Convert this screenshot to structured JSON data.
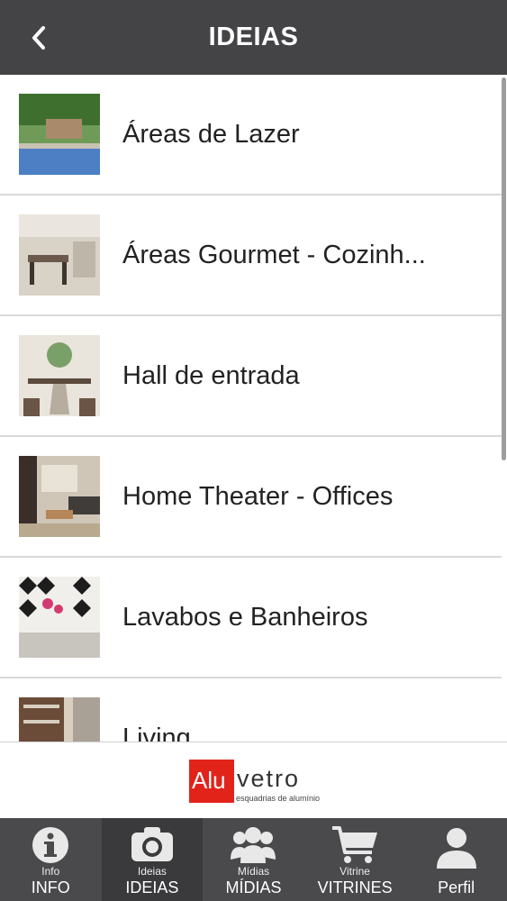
{
  "header": {
    "title": "IDEIAS"
  },
  "items": [
    {
      "label": "Áreas de Lazer"
    },
    {
      "label": "Áreas Gourmet - Cozinh..."
    },
    {
      "label": "Hall de entrada"
    },
    {
      "label": "Home Theater - Offices"
    },
    {
      "label": "Lavabos e Banheiros"
    },
    {
      "label": "Living"
    }
  ],
  "logo": {
    "alu": "Alu",
    "vetro": "vetro",
    "subtitle": "esquadrias de alumínio"
  },
  "tabs": [
    {
      "small": "Info",
      "big": "INFO",
      "icon": "info-icon"
    },
    {
      "small": "Ideias",
      "big": "IDEIAS",
      "icon": "camera-icon"
    },
    {
      "small": "Mídias",
      "big": "MÍDIAS",
      "icon": "people-icon"
    },
    {
      "small": "Vitrine",
      "big": "VITRINES",
      "icon": "cart-icon"
    },
    {
      "small": "",
      "big": "Perfil",
      "icon": "user-icon"
    }
  ],
  "colors": {
    "header": "#444345",
    "tabbar": "#4a494b",
    "brand_red": "#e2231a"
  }
}
